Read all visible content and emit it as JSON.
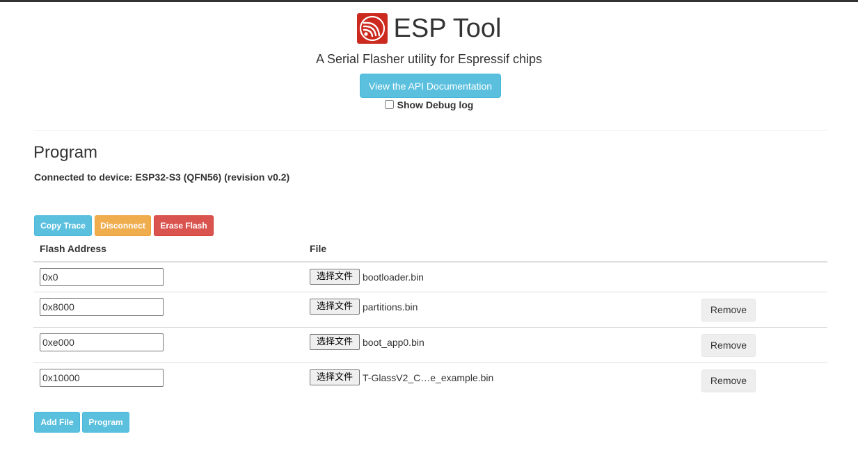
{
  "header": {
    "title": "ESP Tool",
    "subtitle": "A Serial Flasher utility for Espressif chips",
    "api_button": "View the API Documentation",
    "debug_label": "Show Debug log",
    "debug_checked": false
  },
  "program": {
    "section_title": "Program",
    "connected_text": "Connected to device: ESP32-S3 (QFN56) (revision v0.2)",
    "buttons": {
      "copy_trace": "Copy Trace",
      "disconnect": "Disconnect",
      "erase_flash": "Erase Flash"
    },
    "table": {
      "col_address": "Flash Address",
      "col_file": "File",
      "rows": [
        {
          "address": "0x0",
          "choose_label": "选择文件",
          "file": "bootloader.bin",
          "remove": ""
        },
        {
          "address": "0x8000",
          "choose_label": "选择文件",
          "file": "partitions.bin",
          "remove": "Remove"
        },
        {
          "address": "0xe000",
          "choose_label": "选择文件",
          "file": "boot_app0.bin",
          "remove": "Remove"
        },
        {
          "address": "0x10000",
          "choose_label": "选择文件",
          "file": "T-GlassV2_C…e_example.bin",
          "remove": "Remove"
        }
      ]
    },
    "footer_buttons": {
      "add_file": "Add File",
      "program": "Program"
    }
  },
  "colors": {
    "info": "#5bc0de",
    "warning": "#f0ad4e",
    "danger": "#d9534f",
    "logo_red": "#cc2a1e"
  },
  "icons": {
    "logo": "espressif-logo-icon"
  }
}
